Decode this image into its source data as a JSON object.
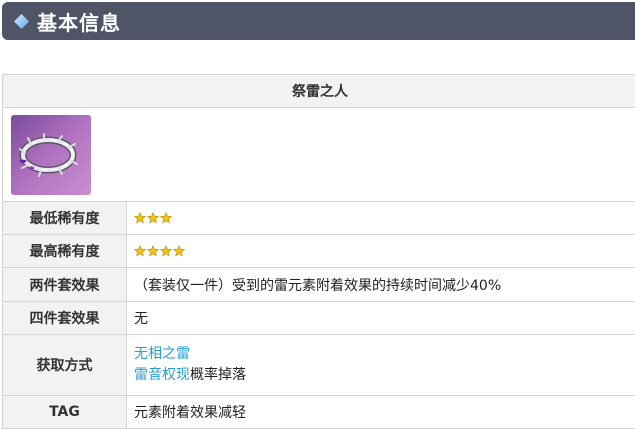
{
  "header": {
    "title": "基本信息",
    "diamond_color": "#8fc8ff"
  },
  "artifact": {
    "name": "祭雷之人",
    "image_icon": "silver-thorn-circlet-icon",
    "image_bg": "#b072c0"
  },
  "rows": {
    "min_rarity": {
      "label": "最低稀有度",
      "stars": 3
    },
    "max_rarity": {
      "label": "最高稀有度",
      "stars": 4
    },
    "two_piece": {
      "label": "两件套效果",
      "value": "（套装仅一件）受到的雷元素附着效果的持续时间减少40%"
    },
    "four_piece": {
      "label": "四件套效果",
      "value": "无"
    },
    "source": {
      "label": "获取方式",
      "link1": "无相之雷",
      "link2": "雷音权现",
      "suffix2": "概率掉落"
    },
    "tag": {
      "label": "TAG",
      "value": "元素附着效果减轻"
    }
  },
  "colors": {
    "link": "#2a9fd6",
    "star_fill": "#f1c40f",
    "star_stroke": "#c79a1e",
    "header_bg": "#4f5466"
  }
}
